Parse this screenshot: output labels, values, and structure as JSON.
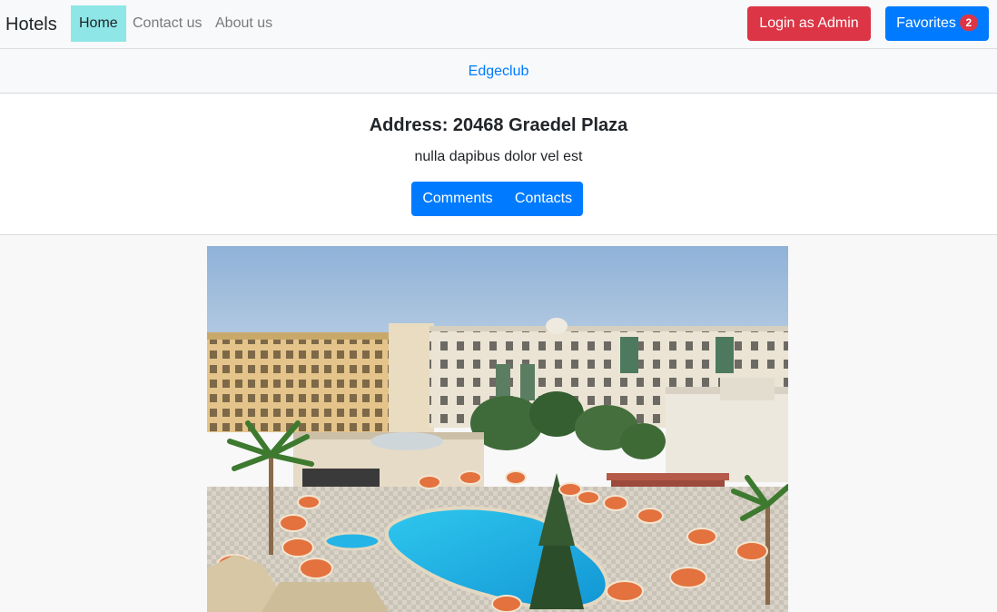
{
  "navbar": {
    "brand": "Hotels",
    "links": [
      {
        "label": "Home",
        "active": true
      },
      {
        "label": "Contact us",
        "active": false
      },
      {
        "label": "About us",
        "active": false
      }
    ],
    "login_label": "Login as Admin",
    "favorites_label": "Favorites",
    "favorites_count": "2"
  },
  "hotel": {
    "name": "Edgeclub",
    "address": "Address: 20468 Graedel Plaza",
    "description": "nulla dapibus dolor vel est",
    "comments_label": "Comments",
    "contacts_label": "Contacts",
    "image_alt": "hotel-photo"
  },
  "colors": {
    "primary": "#007bff",
    "danger": "#dc3545",
    "active_nav": "#8ee6e6"
  }
}
